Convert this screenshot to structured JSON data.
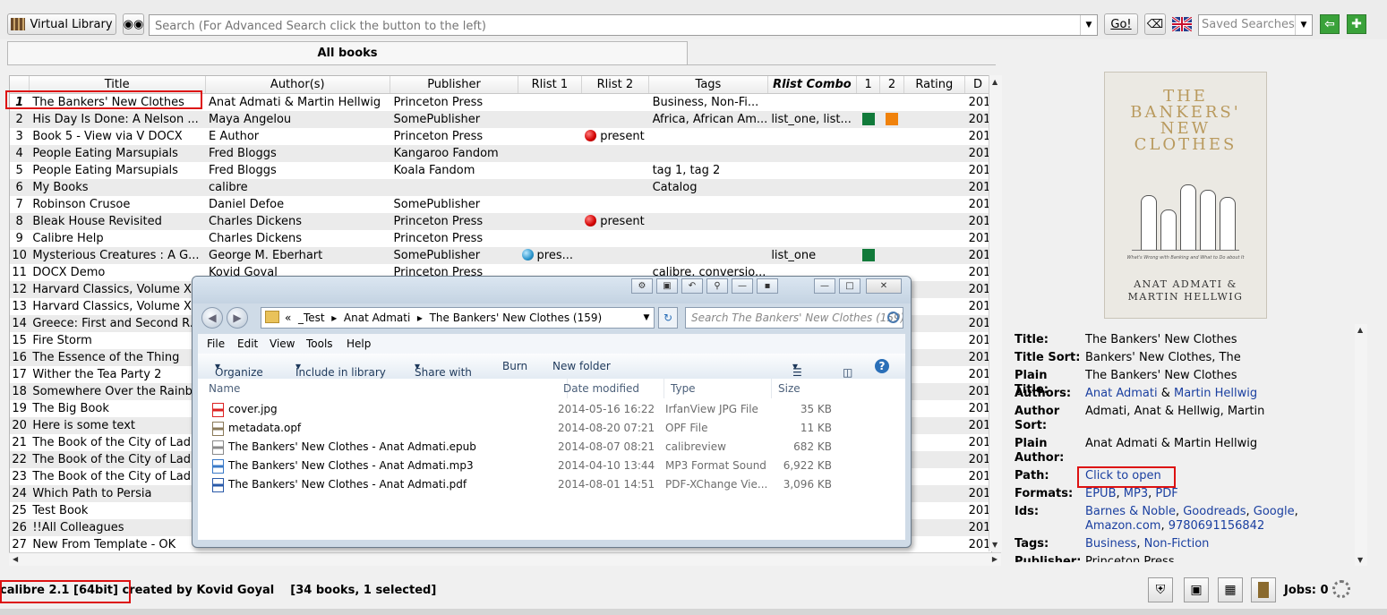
{
  "toolbar": {
    "virtual_library_label": "Virtual Library",
    "search_placeholder": "Search (For Advanced Search click the button to the left)",
    "go_label": "Go!",
    "saved_searches_placeholder": "Saved Searches"
  },
  "library_tab": "All books",
  "table": {
    "columns": [
      "Title",
      "Author(s)",
      "Publisher",
      "Rlist 1",
      "Rlist 2",
      "Tags",
      "Rlist Combo",
      "1",
      "2",
      "Rating",
      "D"
    ],
    "rows": [
      {
        "n": "1",
        "title": "The Bankers' New Clothes",
        "author": "Anat Admati & Martin Hellwig",
        "publisher": "Princeton Press",
        "rlist1": "",
        "rlist2": "",
        "tags": "Business, Non-Fi...",
        "combo": "",
        "c1": "",
        "c2": "",
        "date": "201"
      },
      {
        "n": "2",
        "title": "His Day Is Done: A Nelson ...",
        "author": "Maya Angelou",
        "publisher": "SomePublisher",
        "rlist1": "",
        "rlist2": "",
        "tags": "Africa, African Am...",
        "combo": "list_one, list...",
        "c1": "#117a3a",
        "c2": "#f0820c",
        "date": "201"
      },
      {
        "n": "3",
        "title": "Book 5 - View via V DOCX",
        "author": "E Author",
        "publisher": "Princeton Press",
        "rlist1": "",
        "rlist2": "present",
        "tags": "",
        "combo": "",
        "c1": "",
        "c2": "",
        "date": "201"
      },
      {
        "n": "4",
        "title": "People Eating Marsupials",
        "author": "Fred Bloggs",
        "publisher": "Kangaroo Fandom",
        "rlist1": "",
        "rlist2": "",
        "tags": "",
        "combo": "",
        "c1": "",
        "c2": "",
        "date": "201"
      },
      {
        "n": "5",
        "title": "People Eating Marsupials",
        "author": "Fred Bloggs",
        "publisher": "Koala Fandom",
        "rlist1": "",
        "rlist2": "",
        "tags": "tag 1, tag 2",
        "combo": "",
        "c1": "",
        "c2": "",
        "date": "201"
      },
      {
        "n": "6",
        "title": "My Books",
        "author": "calibre",
        "publisher": "",
        "rlist1": "",
        "rlist2": "",
        "tags": "Catalog",
        "combo": "",
        "c1": "",
        "c2": "",
        "date": "201"
      },
      {
        "n": "7",
        "title": "Robinson Crusoe",
        "author": "Daniel Defoe",
        "publisher": "SomePublisher",
        "rlist1": "",
        "rlist2": "",
        "tags": "",
        "combo": "",
        "c1": "",
        "c2": "",
        "date": "201"
      },
      {
        "n": "8",
        "title": "Bleak House Revisited",
        "author": "Charles Dickens",
        "publisher": "Princeton Press",
        "rlist1": "",
        "rlist2": "present",
        "tags": "",
        "combo": "",
        "c1": "",
        "c2": "",
        "date": "201"
      },
      {
        "n": "9",
        "title": "Calibre Help",
        "author": "Charles Dickens",
        "publisher": "Princeton Press",
        "rlist1": "",
        "rlist2": "",
        "tags": "",
        "combo": "",
        "c1": "",
        "c2": "",
        "date": "201"
      },
      {
        "n": "10",
        "title": "Mysterious Creatures : A G...",
        "author": "George M. Eberhart",
        "publisher": "SomePublisher",
        "rlist1": "pres...",
        "rlist2": "",
        "tags": "",
        "combo": "list_one",
        "c1": "#117a3a",
        "c2": "",
        "date": "201"
      },
      {
        "n": "11",
        "title": "DOCX Demo",
        "author": "Kovid Goyal",
        "publisher": "Princeton Press",
        "rlist1": "",
        "rlist2": "",
        "tags": "calibre, conversio...",
        "combo": "",
        "c1": "",
        "c2": "",
        "date": "201"
      },
      {
        "n": "12",
        "title": "Harvard Classics, Volume XL",
        "author": "",
        "publisher": "",
        "rlist1": "",
        "rlist2": "",
        "tags": "",
        "combo": "",
        "c1": "",
        "c2": "",
        "date": "201"
      },
      {
        "n": "13",
        "title": "Harvard Classics, Volume XL",
        "author": "",
        "publisher": "",
        "rlist1": "",
        "rlist2": "",
        "tags": "",
        "combo": "",
        "c1": "",
        "c2": "",
        "date": "201"
      },
      {
        "n": "14",
        "title": "Greece: First and Second R...",
        "author": "",
        "publisher": "",
        "rlist1": "",
        "rlist2": "",
        "tags": "",
        "combo": "",
        "c1": "",
        "c2": "",
        "date": "201"
      },
      {
        "n": "15",
        "title": "Fire Storm",
        "author": "",
        "publisher": "",
        "rlist1": "",
        "rlist2": "",
        "tags": "",
        "combo": "",
        "c1": "",
        "c2": "",
        "date": "201"
      },
      {
        "n": "16",
        "title": "The Essence of the Thing",
        "author": "",
        "publisher": "",
        "rlist1": "",
        "rlist2": "",
        "tags": "",
        "combo": "",
        "c1": "",
        "c2": "",
        "date": "201"
      },
      {
        "n": "17",
        "title": "Wither the Tea Party 2",
        "author": "",
        "publisher": "",
        "rlist1": "",
        "rlist2": "",
        "tags": "",
        "combo": "",
        "c1": "",
        "c2": "",
        "date": "201"
      },
      {
        "n": "18",
        "title": "Somewhere Over the Rainb...",
        "author": "",
        "publisher": "",
        "rlist1": "",
        "rlist2": "",
        "tags": "",
        "combo": "",
        "c1": "",
        "c2": "",
        "date": "201"
      },
      {
        "n": "19",
        "title": "The Big Book",
        "author": "",
        "publisher": "",
        "rlist1": "",
        "rlist2": "",
        "tags": "",
        "combo": "",
        "c1": "",
        "c2": "",
        "date": "201"
      },
      {
        "n": "20",
        "title": "Here is some text",
        "author": "",
        "publisher": "",
        "rlist1": "",
        "rlist2": "",
        "tags": "",
        "combo": "",
        "c1": "",
        "c2": "",
        "date": "201"
      },
      {
        "n": "21",
        "title": "The Book of the City of Ladi...",
        "author": "",
        "publisher": "",
        "rlist1": "",
        "rlist2": "",
        "tags": "",
        "combo": "",
        "c1": "",
        "c2": "",
        "date": "201"
      },
      {
        "n": "22",
        "title": "The Book of the City of Ladi...",
        "author": "",
        "publisher": "",
        "rlist1": "",
        "rlist2": "",
        "tags": "",
        "combo": "",
        "c1": "",
        "c2": "",
        "date": "201"
      },
      {
        "n": "23",
        "title": "The Book of the City of Ladi...",
        "author": "",
        "publisher": "",
        "rlist1": "",
        "rlist2": "",
        "tags": "",
        "combo": "",
        "c1": "",
        "c2": "",
        "date": "201"
      },
      {
        "n": "24",
        "title": "Which Path to Persia",
        "author": "",
        "publisher": "",
        "rlist1": "",
        "rlist2": "",
        "tags": "",
        "combo": "",
        "c1": "",
        "c2": "",
        "date": "201"
      },
      {
        "n": "25",
        "title": "Test Book",
        "author": "",
        "publisher": "",
        "rlist1": "",
        "rlist2": "",
        "tags": "",
        "combo": "",
        "c1": "",
        "c2": "",
        "date": "201"
      },
      {
        "n": "26",
        "title": "!!All Colleagues",
        "author": "",
        "publisher": "",
        "rlist1": "",
        "rlist2": "",
        "tags": "",
        "combo": "",
        "c1": "",
        "c2": "",
        "date": "201"
      },
      {
        "n": "27",
        "title": "New From Template - OK",
        "author": "",
        "publisher": "",
        "rlist1": "",
        "rlist2": "",
        "tags": "",
        "combo": "",
        "c1": "",
        "c2": "",
        "date": "201"
      }
    ]
  },
  "explorer": {
    "breadcrumb": [
      "«",
      "_Test",
      "Anat Admati",
      "The Bankers' New Clothes (159)"
    ],
    "search_placeholder": "Search The Bankers' New Clothes (159)",
    "menu": [
      "File",
      "Edit",
      "View",
      "Tools",
      "Help"
    ],
    "commands": [
      "Organize",
      "Include in library",
      "Share with",
      "Burn",
      "New folder"
    ],
    "columns": [
      "Name",
      "Date modified",
      "Type",
      "Size"
    ],
    "files": [
      {
        "name": "cover.jpg",
        "date": "2014-05-16 16:22",
        "type": "IrfanView JPG File",
        "size": "35 KB",
        "icon": "irfanview-icon"
      },
      {
        "name": "metadata.opf",
        "date": "2014-08-20 07:21",
        "type": "OPF File",
        "size": "11 KB",
        "icon": "opf-file-icon"
      },
      {
        "name": "The Bankers' New Clothes - Anat Admati.epub",
        "date": "2014-08-07 08:21",
        "type": "calibreview",
        "size": "682 KB",
        "icon": "epub-file-icon"
      },
      {
        "name": "The Bankers' New Clothes - Anat Admati.mp3",
        "date": "2014-04-10 13:44",
        "type": "MP3 Format Sound",
        "size": "6,922 KB",
        "icon": "mp3-file-icon"
      },
      {
        "name": "The Bankers' New Clothes - Anat Admati.pdf",
        "date": "2014-08-01 14:51",
        "type": "PDF-XChange Vie...",
        "size": "3,096 KB",
        "icon": "pdf-file-icon"
      }
    ]
  },
  "cover": {
    "title_lines": [
      "THE",
      "BANKERS'",
      "NEW",
      "CLOTHES"
    ],
    "tagline": "What's Wrong with Banking and What to Do about It",
    "author_lines": [
      "ANAT ADMATI &",
      "MARTIN HELLWIG"
    ]
  },
  "details": {
    "title_key": "Title:",
    "title_val": "The Bankers' New Clothes",
    "title_sort_key": "Title Sort:",
    "title_sort_val": "Bankers' New Clothes, The",
    "plain_title_key": "Plain Title:",
    "plain_title_val": "The Bankers' New Clothes",
    "authors_key": "Authors:",
    "author1": "Anat Admati",
    "amp": " & ",
    "author2": "Martin Hellwig",
    "author_sort_key": "Author Sort:",
    "author_sort_val": "Admati, Anat & Hellwig, Martin",
    "plain_author_key": "Plain Author:",
    "plain_author_val": "Anat Admati & Martin Hellwig",
    "path_key": "Path:",
    "path_val": "Click to open",
    "formats_key": "Formats:",
    "formats_val": [
      "EPUB",
      "MP3",
      "PDF"
    ],
    "ids_key": "Ids:",
    "ids_line1": [
      "Barnes & Noble",
      "Goodreads",
      "Google"
    ],
    "ids_line2": [
      "Amazon.com",
      "9780691156842"
    ],
    "tags_key": "Tags:",
    "tags_val": [
      "Business",
      "Non-Fiction"
    ],
    "publisher_key": "Publisher:",
    "publisher_val": "Princeton Press"
  },
  "status": {
    "text": "calibre 2.1 [64bit] created by Kovid Goyal    [34 books, 1 selected]",
    "jobs": "Jobs: 0"
  },
  "colors": {
    "selection_box": "#d11111",
    "link": "#1a3fa0",
    "green_flag": "#117a3a",
    "orange_flag": "#f0820c"
  }
}
